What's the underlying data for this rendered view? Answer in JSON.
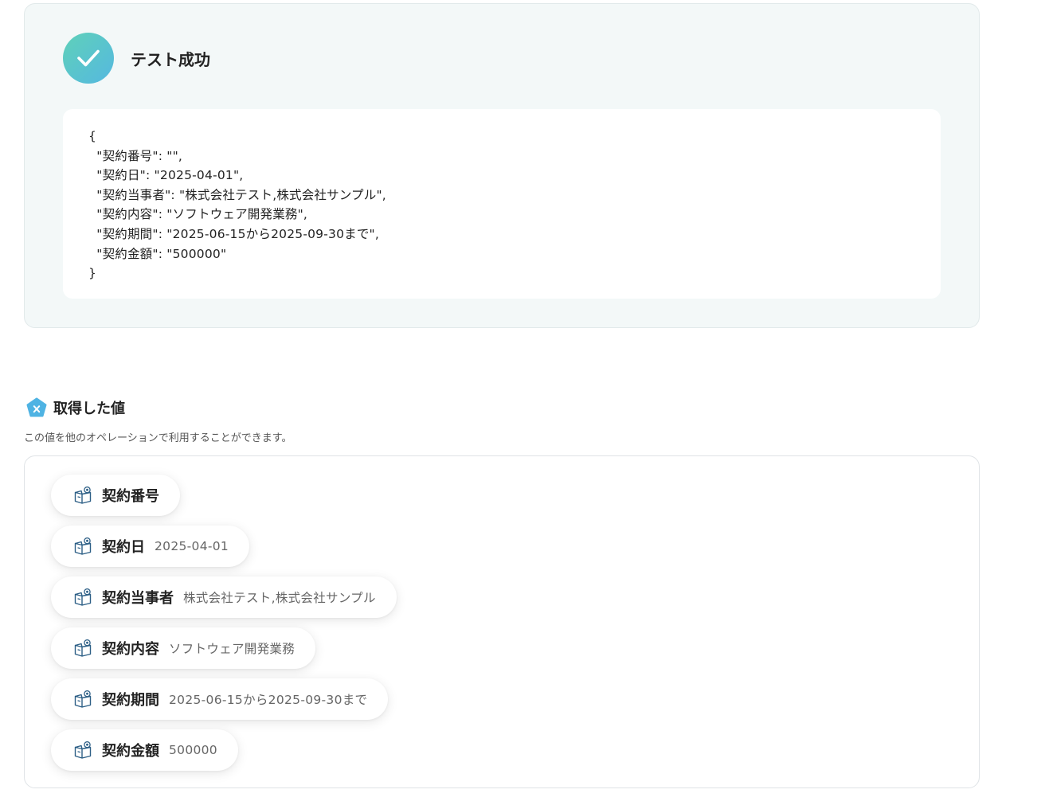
{
  "test_result": {
    "status_icon": "check-icon",
    "title": "テスト成功",
    "json_lines": [
      "{",
      "  \"契約番号\": \"\",",
      "  \"契約日\": \"2025-04-01\",",
      "  \"契約当事者\": \"株式会社テスト,株式会社サンプル\",",
      "  \"契約内容\": \"ソフトウェア開発業務\",",
      "  \"契約期間\": \"2025-06-15から2025-09-30まで\",",
      "  \"契約金額\": \"500000\"",
      "}"
    ]
  },
  "retrieved_values": {
    "icon": "pentagon-x-icon",
    "title": "取得した値",
    "description": "この値を他のオペレーションで利用することができます。",
    "items": [
      {
        "key": "契約番号",
        "value": ""
      },
      {
        "key": "契約日",
        "value": "2025-04-01"
      },
      {
        "key": "契約当事者",
        "value": "株式会社テスト,株式会社サンプル"
      },
      {
        "key": "契約内容",
        "value": "ソフトウェア開発業務"
      },
      {
        "key": "契約期間",
        "value": "2025-06-15から2025-09-30まで"
      },
      {
        "key": "契約金額",
        "value": "500000"
      }
    ]
  },
  "colors": {
    "success_gradient_start": "#5fd1b9",
    "success_gradient_end": "#55b8e0",
    "panel_background": "#f3f8f8",
    "accent_blue": "#4fb3e3"
  }
}
